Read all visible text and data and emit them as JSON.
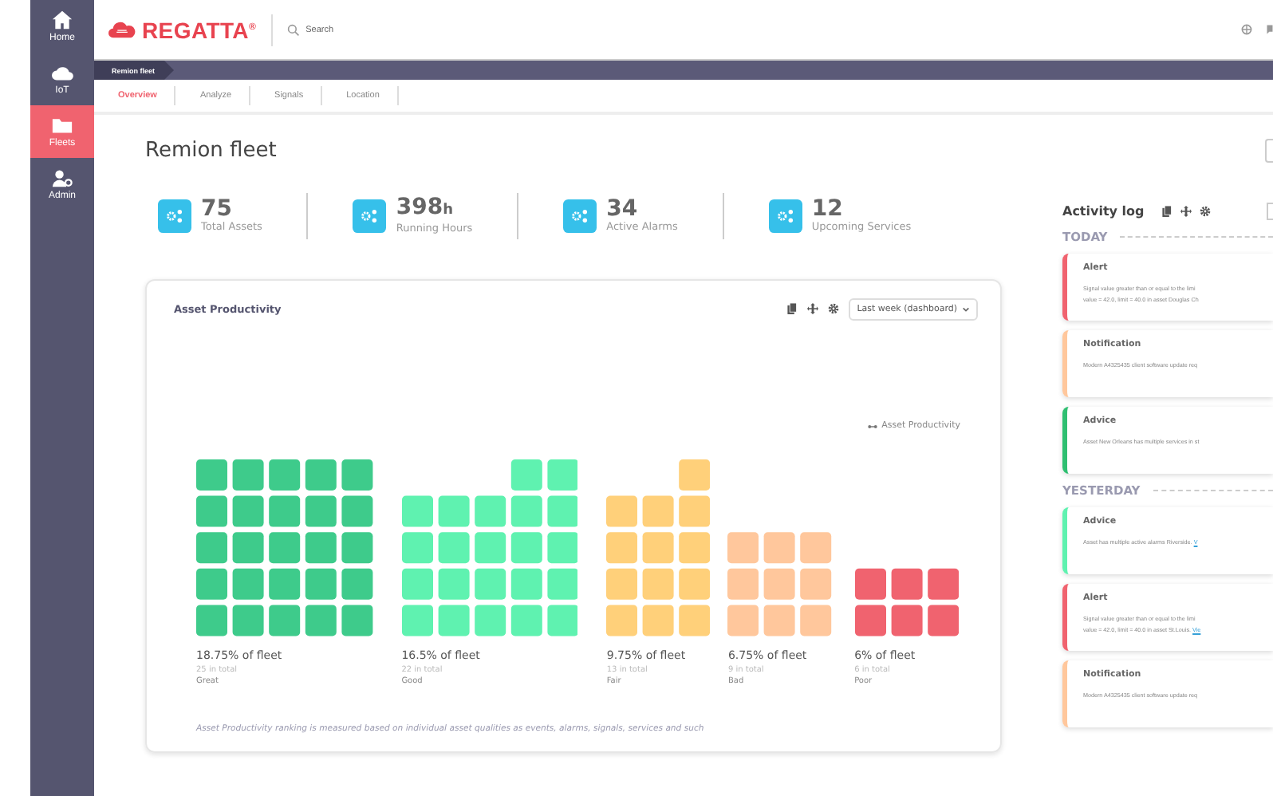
{
  "sidebar": {
    "items": [
      {
        "kind": "home",
        "label": "Home",
        "selected": false
      },
      {
        "kind": "cloud",
        "label": "IoT",
        "selected": false
      },
      {
        "kind": "folder",
        "label": "Fleets",
        "selected": true
      },
      {
        "kind": "admin",
        "label": "Admin",
        "selected": false
      }
    ]
  },
  "header": {
    "logo": "REGATTA$^{®}$",
    "search": {
      "placeholder": "Search"
    }
  },
  "breadcrumb": "Remion fleet",
  "tabs": [
    {
      "label": "Overview",
      "selected": true
    },
    {
      "label": "Analyze",
      "selected": false
    },
    {
      "label": "Signals",
      "selected": false
    },
    {
      "label": "Location",
      "selected": false
    }
  ],
  "title": "Remion fleet",
  "stats": [
    {
      "value": "75",
      "label": "Total Assets"
    },
    {
      "value": "398",
      "unit": "h",
      "label": "Running Hours"
    },
    {
      "value": "34",
      "label": "Active Alarms"
    },
    {
      "value": "12",
      "label": "Upcoming Services"
    }
  ],
  "productivity": {
    "title": "Asset Productivity",
    "period": "Last week (dashboard)",
    "legend": "Asset Productivity",
    "groups": [
      {
        "share": "18.75% of fleet",
        "total": "25 in total",
        "label": "Great",
        "color": "#3ecb8b"
      },
      {
        "share": "16.5% of fleet",
        "total": "22 in total",
        "label": "Good",
        "color": "#5ff2b0"
      },
      {
        "share": "9.75% of fleet",
        "total": "13 in total",
        "label": "Fair",
        "color": "#ffd07a"
      },
      {
        "share": "6.75% of fleet",
        "total": "9 in total",
        "label": "Bad",
        "color": "#ffc79c"
      },
      {
        "share": "6% of fleet",
        "total": "6 in total",
        "label": "Poor",
        "color": "#f0636f"
      }
    ],
    "note": "Asset Productivity ranking  is measured based on individual asset qualities as events, alarms, signals, services and such"
  },
  "activity_log": {
    "title": "Activity log",
    "sections": [
      {
        "heading": "TODAY",
        "entries": [
          {
            "title": "Alert",
            "color": "#f0636f",
            "lines": [
              "Signal value greater than or equal to the limi",
              "value = 42.0, limit = 40.0 in asset Douglas Ch"
            ]
          },
          {
            "title": "Notification",
            "color": "#ffc79c",
            "lines": [
              "Modern A4325435 client software update req"
            ]
          },
          {
            "title": "Advice",
            "color": "#2fbf71",
            "lines": [
              "Asset New Orleans has multiple services in st"
            ]
          }
        ]
      },
      {
        "heading": "YESTERDAY",
        "entries": [
          {
            "title": "Advice",
            "color": "#5ff2b0",
            "lines": [
              "Asset  has multiple active alarms Riverside."
            ],
            "link": "V"
          },
          {
            "title": "Alert",
            "color": "#f0636f",
            "lines": [
              "Signal value greater than or equal to the limi",
              "value = 42.0, limit = 40.0 in asset St.Louis."
            ],
            "link": "Vie"
          },
          {
            "title": "Notification",
            "color": "#ffc79c",
            "lines": [
              "Modern A4325435 client software update req"
            ]
          }
        ]
      }
    ]
  }
}
